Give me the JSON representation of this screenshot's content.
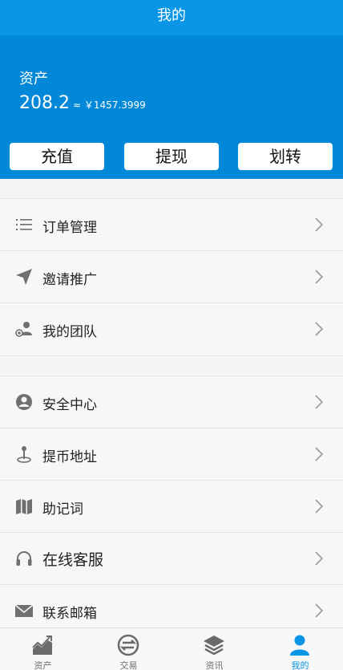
{
  "header": {
    "title": "我的"
  },
  "assets": {
    "label": "资产",
    "amount": "208.2",
    "approx": "≈ ￥1457.3999",
    "buttons": [
      {
        "label": "充值"
      },
      {
        "label": "提现"
      },
      {
        "label": "划转"
      }
    ]
  },
  "menu_group_1": [
    {
      "label": "订单管理",
      "icon": "list-icon"
    },
    {
      "label": "邀请推广",
      "icon": "paper-plane-icon"
    },
    {
      "label": "我的团队",
      "icon": "team-icon"
    }
  ],
  "menu_group_2": [
    {
      "label": "安全中心",
      "icon": "user-circle-icon"
    },
    {
      "label": "提币地址",
      "icon": "location-pin-icon"
    },
    {
      "label": "助记词",
      "icon": "map-icon"
    },
    {
      "label": "在线客服",
      "icon": "headset-icon"
    },
    {
      "label": "联系邮箱",
      "icon": "envelope-icon"
    }
  ],
  "tabbar": [
    {
      "label": "资产",
      "icon": "chart-icon",
      "active": false
    },
    {
      "label": "交易",
      "icon": "exchange-icon",
      "active": false
    },
    {
      "label": "资讯",
      "icon": "layers-icon",
      "active": false
    },
    {
      "label": "我的",
      "icon": "user-icon",
      "active": true
    }
  ],
  "colors": {
    "primary": "#0a96e6",
    "hero": "#0288d8",
    "icon": "#606060"
  }
}
